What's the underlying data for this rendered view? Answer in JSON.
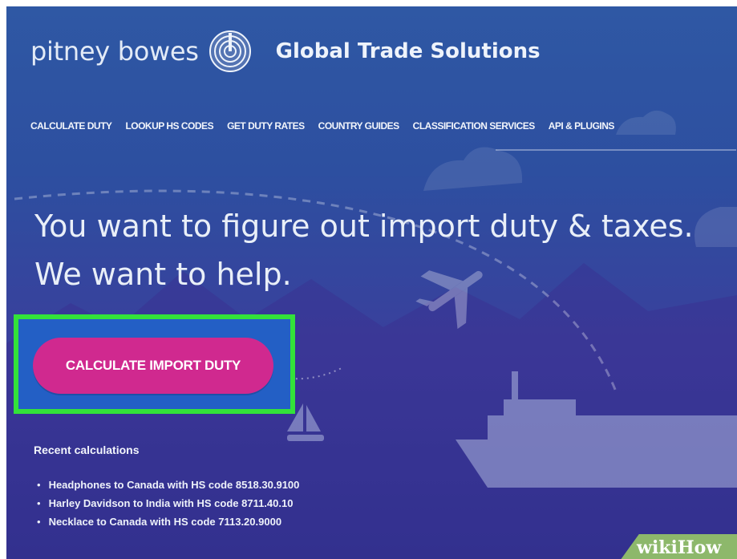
{
  "header": {
    "brand": "pitney bowes",
    "logo_icon": "pitney-bowes-logo-icon",
    "site_title": "Global Trade Solutions"
  },
  "nav": {
    "items": [
      "CALCULATE DUTY",
      "LOOKUP HS CODES",
      "GET DUTY RATES",
      "COUNTRY GUIDES",
      "CLASSIFICATION SERVICES",
      "API & PLUGINS"
    ]
  },
  "hero": {
    "headline_line1": "You want to figure out import duty & taxes.",
    "headline_line2": "We want to help.",
    "cta_label": "CALCULATE IMPORT DUTY"
  },
  "recent": {
    "heading": "Recent calculations",
    "items": [
      "Headphones to Canada with HS code 8518.30.9100",
      "Harley Davidson to India with HS code 8711.40.10",
      "Necklace to Canada with HS code 7113.20.9000"
    ]
  },
  "watermark": {
    "brand": "wikiHow"
  },
  "colors": {
    "background": "#2f58a4",
    "cta": "#d0298f",
    "highlight": "#33e23a",
    "watermark": "#8db86b"
  }
}
